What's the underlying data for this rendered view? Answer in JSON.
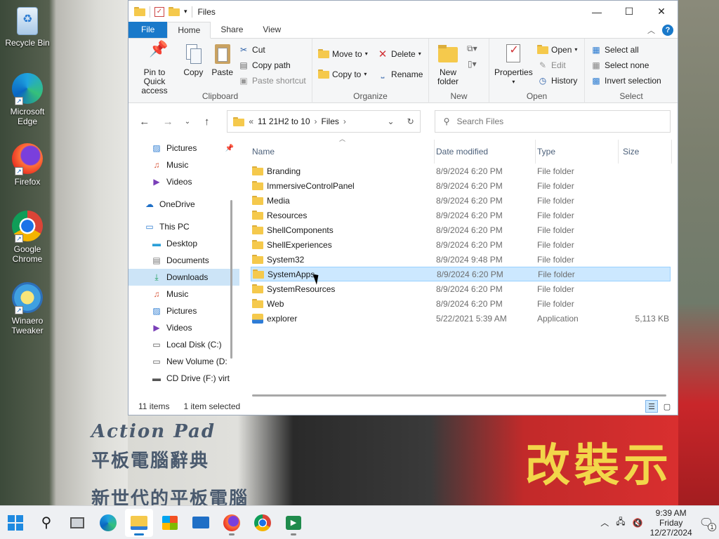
{
  "desktop": {
    "icons": [
      {
        "label": "Recycle Bin"
      },
      {
        "label": "Microsoft Edge"
      },
      {
        "label": "Firefox"
      },
      {
        "label": "Google Chrome"
      },
      {
        "label": "Winaero Tweaker"
      }
    ],
    "poster": {
      "line1": "Action Pad",
      "line2": "平板電腦辭典",
      "line3": "新世代的平板電腦",
      "red_text": "改裝示"
    }
  },
  "window": {
    "title": "Files",
    "tabs": [
      "File",
      "Home",
      "Share",
      "View"
    ],
    "active_tab": "Home",
    "ribbon": {
      "clipboard": {
        "label": "Clipboard",
        "pin": "Pin to Quick access",
        "copy": "Copy",
        "paste": "Paste",
        "cut": "Cut",
        "copy_path": "Copy path",
        "paste_shortcut": "Paste shortcut"
      },
      "organize": {
        "label": "Organize",
        "move_to": "Move to",
        "copy_to": "Copy to",
        "delete": "Delete",
        "rename": "Rename"
      },
      "new": {
        "label": "New",
        "new_folder": "New folder"
      },
      "open": {
        "label": "Open",
        "properties": "Properties",
        "open": "Open",
        "edit": "Edit",
        "history": "History"
      },
      "select": {
        "label": "Select",
        "select_all": "Select all",
        "select_none": "Select none",
        "invert": "Invert selection"
      }
    },
    "address": {
      "prefix": "«",
      "crumbs": [
        "11 21H2 to 10",
        "Files"
      ]
    },
    "search": {
      "placeholder": "Search Files"
    },
    "nav": [
      {
        "label": "Pictures",
        "icon": "pictures-icon",
        "pinned": true
      },
      {
        "label": "Music",
        "icon": "music-icon"
      },
      {
        "label": "Videos",
        "icon": "videos-icon"
      },
      {
        "label": "OneDrive",
        "icon": "onedrive-icon",
        "top": true
      },
      {
        "label": "This PC",
        "icon": "pc-icon",
        "top": true
      },
      {
        "label": "Desktop",
        "icon": "desktop-icon"
      },
      {
        "label": "Documents",
        "icon": "documents-icon"
      },
      {
        "label": "Downloads",
        "icon": "downloads-icon",
        "selected": true
      },
      {
        "label": "Music",
        "icon": "music-icon"
      },
      {
        "label": "Pictures",
        "icon": "pictures-icon"
      },
      {
        "label": "Videos",
        "icon": "videos-icon"
      },
      {
        "label": "Local Disk (C:)",
        "icon": "drive-icon"
      },
      {
        "label": "New Volume (D:",
        "icon": "drive-icon"
      },
      {
        "label": "CD Drive (F:) virt",
        "icon": "cd-drive-icon"
      }
    ],
    "columns": {
      "name": "Name",
      "date": "Date modified",
      "type": "Type",
      "size": "Size"
    },
    "files": [
      {
        "name": "Branding",
        "date": "8/9/2024 6:20 PM",
        "type": "File folder",
        "size": ""
      },
      {
        "name": "ImmersiveControlPanel",
        "date": "8/9/2024 6:20 PM",
        "type": "File folder",
        "size": ""
      },
      {
        "name": "Media",
        "date": "8/9/2024 6:20 PM",
        "type": "File folder",
        "size": ""
      },
      {
        "name": "Resources",
        "date": "8/9/2024 6:20 PM",
        "type": "File folder",
        "size": ""
      },
      {
        "name": "ShellComponents",
        "date": "8/9/2024 6:20 PM",
        "type": "File folder",
        "size": ""
      },
      {
        "name": "ShellExperiences",
        "date": "8/9/2024 6:20 PM",
        "type": "File folder",
        "size": ""
      },
      {
        "name": "System32",
        "date": "8/9/2024 9:48 PM",
        "type": "File folder",
        "size": ""
      },
      {
        "name": "SystemApps",
        "date": "8/9/2024 6:20 PM",
        "type": "File folder",
        "size": "",
        "selected": true
      },
      {
        "name": "SystemResources",
        "date": "8/9/2024 6:20 PM",
        "type": "File folder",
        "size": ""
      },
      {
        "name": "Web",
        "date": "8/9/2024 6:20 PM",
        "type": "File folder",
        "size": ""
      },
      {
        "name": "explorer",
        "date": "5/22/2021 5:39 AM",
        "type": "Application",
        "size": "5,113 KB",
        "app": true
      }
    ],
    "status": {
      "count": "11 items",
      "selection": "1 item selected"
    }
  },
  "taskbar": {
    "clock": {
      "time": "9:39 AM",
      "day": "Friday",
      "date": "12/27/2024"
    },
    "notification_count": "1"
  }
}
